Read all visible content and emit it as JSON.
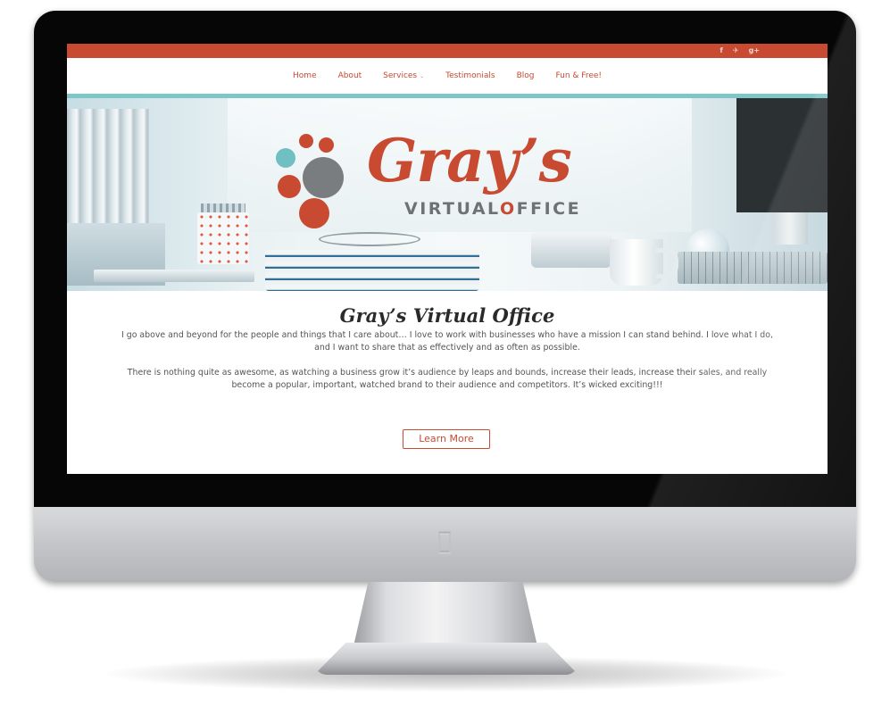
{
  "topbar": {
    "social_icons": [
      {
        "icon": "facebook-icon",
        "glyph": "f"
      },
      {
        "icon": "twitter-icon",
        "glyph": "✈"
      },
      {
        "icon": "google-plus-icon",
        "glyph": "g+"
      }
    ]
  },
  "nav": {
    "items": [
      {
        "label": "Home",
        "name": "nav-item-home",
        "has_dropdown": false
      },
      {
        "label": "About",
        "name": "nav-item-about",
        "has_dropdown": false
      },
      {
        "label": "Services",
        "name": "nav-item-services",
        "has_dropdown": true
      },
      {
        "label": "Testimonials",
        "name": "nav-item-testimonials",
        "has_dropdown": false
      },
      {
        "label": "Blog",
        "name": "nav-item-blog",
        "has_dropdown": false
      },
      {
        "label": "Fun & Free!",
        "name": "nav-item-fun-free",
        "has_dropdown": false
      }
    ]
  },
  "hero": {
    "logo_word": "Gray’s",
    "logo_sub_before": "VIRTUAL",
    "logo_sub_o": "O",
    "logo_sub_after": "FFICE"
  },
  "content": {
    "title": "Gray’s Virtual Office",
    "paragraph_1": "I go above and beyond for the people and things that I care about… I love to work with businesses who have a mission I can stand behind. I love what I do, and I want to share that as effectively and as often as possible.",
    "paragraph_2": "There is nothing quite as awesome, as watching a business grow it’s audience by leaps and bounds, increase their leads, increase their sales, and really become a popular, important, watched brand to their audience and competitors. It’s wicked exciting!!!",
    "button_label": "Learn More"
  },
  "colors": {
    "accent_red": "#c74a31",
    "accent_teal": "#7ec7c9",
    "gray": "#7a7d80"
  }
}
